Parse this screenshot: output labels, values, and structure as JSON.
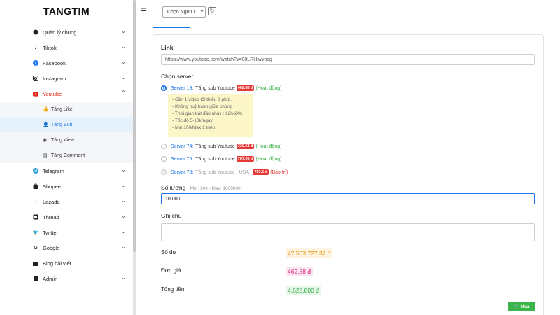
{
  "app": {
    "logo": "TANGTIM"
  },
  "topbar": {
    "language_select": "Chọn Ngôn ı",
    "refresh_icon": "refresh-icon",
    "menu_icon": "menu-toggle-icon"
  },
  "sidebar": {
    "items": [
      {
        "label": "Quản lý chung",
        "icon": "settings-icon",
        "expanded": false
      },
      {
        "label": "Tiktok",
        "icon": "tiktok-icon",
        "expanded": false
      },
      {
        "label": "Facebook",
        "icon": "facebook-icon",
        "expanded": false
      },
      {
        "label": "Instagram",
        "icon": "instagram-icon",
        "expanded": false
      },
      {
        "label": "Youtube",
        "icon": "youtube-icon",
        "expanded": true
      }
    ],
    "youtube_sub": [
      {
        "label": "Tăng Like",
        "icon": "thumbs-up-icon"
      },
      {
        "label": "Tăng Sub",
        "icon": "user-plus-icon",
        "active": true
      },
      {
        "label": "Tăng View",
        "icon": "eye-icon"
      },
      {
        "label": "Tăng Comment",
        "icon": "comment-icon"
      }
    ],
    "items_after": [
      {
        "label": "Telegram",
        "icon": "telegram-icon"
      },
      {
        "label": "Shopee",
        "icon": "shopee-icon"
      },
      {
        "label": "Lazada",
        "icon": "heart-icon"
      },
      {
        "label": "Thread",
        "icon": "thread-icon"
      },
      {
        "label": "Twitter",
        "icon": "twitter-icon"
      },
      {
        "label": "Google",
        "icon": "google-icon"
      },
      {
        "label": "Blog bài viết",
        "icon": "folder-icon"
      },
      {
        "label": "Admin",
        "icon": "admin-icon"
      }
    ]
  },
  "form": {
    "link_label": "Link",
    "link_value": "https://www.youtube.com/watch?v=08LRHjwvncg",
    "server_label": "Chọn server",
    "servers": [
      {
        "name": "Server 19:",
        "desc": "Tăng sub Youtube",
        "price": "462.88 đ",
        "status": "(Hoạt động)",
        "selected": true
      },
      {
        "name": "Server 74:",
        "desc": "Tăng sub Youtube",
        "price": "330.63 đ",
        "status": "(Hoạt động)"
      },
      {
        "name": "Server 75:",
        "desc": "Tăng sub Youtube",
        "price": "767.05 đ",
        "status": "(Hoạt động)"
      },
      {
        "name": "Server 78:",
        "desc": "Tăng sub Youtube [ USA ]",
        "price": "793.5 đ",
        "status": "(Bảo trì)",
        "disabled": true
      }
    ],
    "server_info": [
      "- Cần 1 video tối thiểu 3 phút.",
      "- Không huỷ hoàn giữa chừng",
      "- Thời gian bắt đầu nhảy : 12h-24h",
      "- Tốc độ 5-10k/ngày",
      "- Min 100/Max 1 triệu"
    ],
    "quantity_label": "Số lượng",
    "quantity_hint": "Min: 100 - Max: 1000000",
    "quantity_value": "10,000",
    "note_label": "Ghi chú",
    "balance_label": "Số dư",
    "balance_value": "47,563,727.37 đ",
    "unit_price_label": "Đơn giá",
    "unit_price_value": "462.88 đ",
    "total_label": "Tổng tiền",
    "total_value": "4,628,800 đ",
    "buy_label": "Mua"
  },
  "colors": {
    "accent": "#1a73e8",
    "danger": "#e53935",
    "success": "#2eaa42",
    "youtube": "#e62117"
  }
}
